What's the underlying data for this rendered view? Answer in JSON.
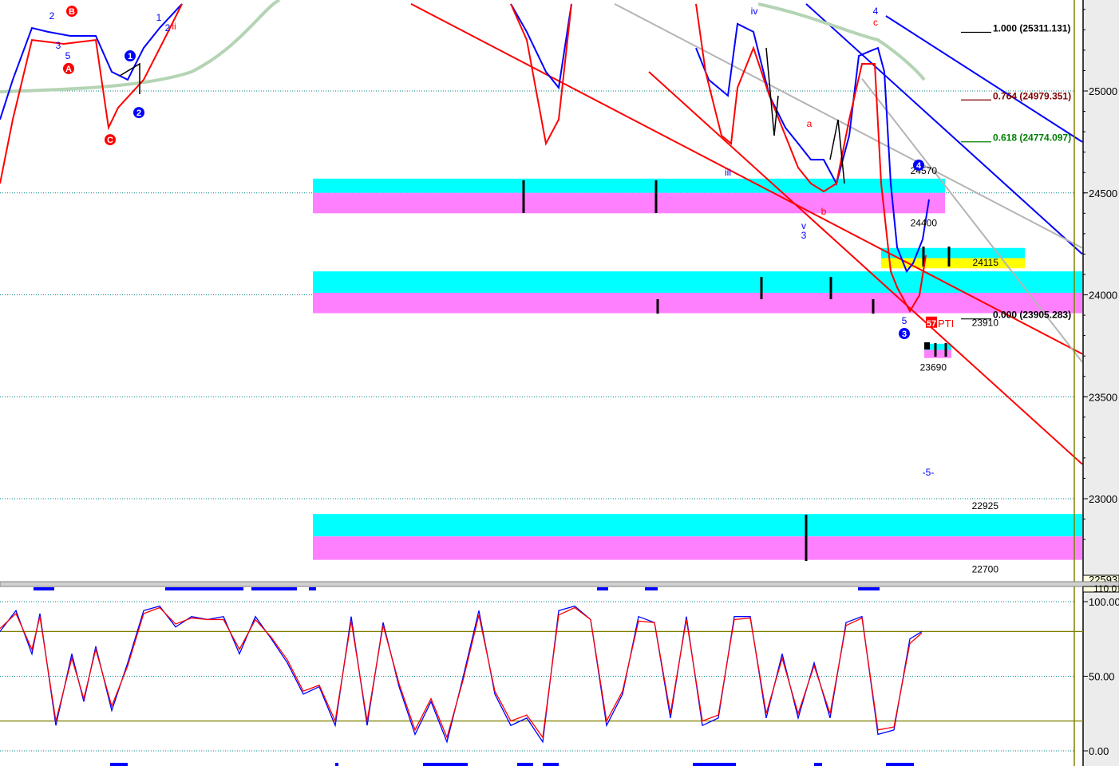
{
  "chart_data": [
    {
      "type": "line",
      "panel": "price",
      "ylim": [
        22593,
        25450
      ],
      "xlim_bars": [
        0,
        350
      ],
      "y_ticks": [
        25000,
        24500,
        24000,
        23500,
        23000
      ],
      "y_tick_labels": [
        "25000",
        "24500",
        "24000",
        "23500",
        "23000"
      ],
      "grid": "dotted horizontal",
      "bottom_readout": "22593",
      "series": [
        {
          "name": "blue-price",
          "color": "#0000ff",
          "segments": [
            [
              [
                0,
                24860
              ],
              [
                4,
                25055
              ],
              [
                10,
                25309
              ],
              [
                15,
                25290
              ],
              [
                22,
                25270
              ],
              [
                30,
                25270
              ],
              [
                35,
                25094
              ],
              [
                40,
                25055
              ],
              [
                45,
                25211
              ],
              [
                50,
                25309
              ],
              [
                57,
                25427
              ]
            ],
            [
              [
                160,
                25427
              ],
              [
                165,
                25290
              ],
              [
                171,
                25094
              ],
              [
                175,
                25016
              ],
              [
                179,
                25427
              ]
            ],
            [
              [
                218,
                25211
              ],
              [
                222,
                25055
              ],
              [
                228,
                24977
              ],
              [
                231,
                25329
              ],
              [
                236,
                25290
              ],
              [
                241,
                24977
              ],
              [
                246,
                24820
              ],
              [
                250,
                24742
              ],
              [
                254,
                24663
              ],
              [
                258,
                24663
              ],
              [
                262,
                24546
              ],
              [
                266,
                24781
              ],
              [
                269,
                25172
              ],
              [
                272,
                25192
              ],
              [
                275,
                25211
              ],
              [
                277,
                25094
              ],
              [
                279,
                24546
              ],
              [
                281,
                24233
              ],
              [
                284,
                24115
              ],
              [
                286,
                24155
              ],
              [
                289,
                24272
              ],
              [
                291,
                24468
              ]
            ]
          ]
        },
        {
          "name": "red-price",
          "color": "#ff0000",
          "segments": [
            [
              [
                0,
                24546
              ],
              [
                4,
                24860
              ],
              [
                10,
                25250
              ],
              [
                20,
                25231
              ],
              [
                30,
                25250
              ],
              [
                34,
                24820
              ],
              [
                37,
                24918
              ],
              [
                45,
                25055
              ],
              [
                52,
                25270
              ],
              [
                57,
                25427
              ]
            ],
            [
              [
                160,
                25427
              ],
              [
                165,
                25250
              ],
              [
                171,
                24742
              ],
              [
                175,
                24860
              ],
              [
                179,
                25427
              ]
            ],
            [
              [
                218,
                25427
              ],
              [
                221,
                25094
              ],
              [
                226,
                24781
              ],
              [
                229,
                24742
              ],
              [
                231,
                25016
              ],
              [
                236,
                25211
              ],
              [
                241,
                24977
              ],
              [
                246,
                24781
              ],
              [
                250,
                24624
              ],
              [
                254,
                24546
              ],
              [
                258,
                24507
              ],
              [
                262,
                24546
              ],
              [
                266,
                24860
              ],
              [
                270,
                25133
              ],
              [
                274,
                25133
              ],
              [
                276,
                24546
              ],
              [
                279,
                24115
              ],
              [
                281,
                24037
              ],
              [
                285,
                23920
              ],
              [
                288,
                23998
              ],
              [
                290,
                24194
              ]
            ]
          ]
        }
      ],
      "trendlines": [
        {
          "color": "#ff0000",
          "from": [
            128.75,
            25427
          ],
          "to": [
            339,
            23710
          ]
        },
        {
          "color": "#ff0000",
          "from": [
            203.25,
            25094
          ],
          "to": [
            339,
            23169
          ]
        },
        {
          "color": "#0000ff",
          "from": [
            252.5,
            25427
          ],
          "to": [
            339,
            24200
          ]
        },
        {
          "color": "#0000ff",
          "from": [
            277.5,
            25368
          ],
          "to": [
            339,
            24750
          ]
        },
        {
          "color": "#b4b4b4",
          "from": [
            192.5,
            25427
          ],
          "to": [
            339,
            24230
          ]
        },
        {
          "color": "#b4b4b4",
          "from": [
            270,
            25060
          ],
          "to": [
            339,
            23670
          ]
        }
      ],
      "zones": [
        {
          "from_bar": 98,
          "to_bar": 296,
          "top": 24570,
          "mid": 24500,
          "bottom": 24400,
          "upper_color": "#00ffff",
          "lower_color": "#ff80ff",
          "label_top": "24570",
          "label_bottom": "24400"
        },
        {
          "from_bar": 98,
          "to_bar": 339,
          "top": 24115,
          "mid": 24010,
          "bottom": 23910,
          "upper_color": "#00ffff",
          "lower_color": "#ff80ff",
          "label_top": "24115",
          "label_bottom": "23910"
        },
        {
          "from_bar": 276,
          "to_bar": 321,
          "top": 24230,
          "mid": 24180,
          "bottom": 24130,
          "upper_color": "#00ffff",
          "lower_color": "#ffff00"
        },
        {
          "from_bar": 289.5,
          "to_bar": 298,
          "top": 23760,
          "mid": 23730,
          "bottom": 23690,
          "upper_color": "#00ffff",
          "lower_color": "#ff80ff",
          "label_bottom": "23690"
        },
        {
          "from_bar": 98,
          "to_bar": 339,
          "top": 22925,
          "mid": 22815,
          "bottom": 22700,
          "upper_color": "#00ffff",
          "lower_color": "#ff80ff",
          "label_top": "22925",
          "label_bottom": "22700"
        }
      ],
      "fib_levels": [
        {
          "label": "1.000 (25311.131)",
          "price": 25311.131,
          "color": "#000000"
        },
        {
          "label": "0.764 (24979.351)",
          "price": 24979.351,
          "color": "#800000"
        },
        {
          "label": "0.618 (24774.097)",
          "price": 24774.097,
          "color": "#008000"
        },
        {
          "label": "0.000 (23905.283)",
          "price": 23905.283,
          "color": "#000000"
        }
      ],
      "wave_labels": [
        {
          "text": "2",
          "bar": 16.25,
          "price": 25368,
          "color": "#0000ff"
        },
        {
          "text": "3",
          "bar": 18.25,
          "price": 25223,
          "color": "#0000ff"
        },
        {
          "text": "5",
          "bar": 21.25,
          "price": 25172,
          "color": "#0000ff"
        },
        {
          "text": "B",
          "bar": 22.5,
          "price": 25391,
          "color": "#ff0000",
          "circle": true
        },
        {
          "text": "A",
          "bar": 21.5,
          "price": 25110,
          "color": "#ff0000",
          "circle": true
        },
        {
          "text": "C",
          "bar": 34.5,
          "price": 24761,
          "color": "#ff0000",
          "circle": true
        },
        {
          "text": "1",
          "bar": 40.75,
          "price": 25172,
          "color": "#0000ff",
          "circle": true
        },
        {
          "text": "2",
          "bar": 43.5,
          "price": 24894,
          "color": "#0000ff",
          "circle": true
        },
        {
          "text": "1",
          "bar": 49.75,
          "price": 25360,
          "color": "#0000ff"
        },
        {
          "text": "2",
          "bar": 52.5,
          "price": 25309,
          "color": "#0000ff"
        },
        {
          "text": "ii",
          "bar": 54.5,
          "price": 25317,
          "color": "#ff0000"
        },
        {
          "text": "iii",
          "bar": 228,
          "price": 24601,
          "color": "#0000ff"
        },
        {
          "text": "iv",
          "bar": 236.25,
          "price": 25391,
          "color": "#0000ff"
        },
        {
          "text": "a",
          "bar": 253.5,
          "price": 24840,
          "color": "#ff0000"
        },
        {
          "text": "b",
          "bar": 258,
          "price": 24409,
          "color": "#ff0000"
        },
        {
          "text": "v",
          "bar": 251.75,
          "price": 24339,
          "color": "#0000ff"
        },
        {
          "text": "3",
          "bar": 251.75,
          "price": 24292,
          "color": "#0000ff"
        },
        {
          "text": "4",
          "bar": 274.25,
          "price": 25391,
          "color": "#0000ff"
        },
        {
          "text": "c",
          "bar": 274.25,
          "price": 25337,
          "color": "#ff0000"
        },
        {
          "text": "4",
          "bar": 287.75,
          "price": 24636,
          "color": "#0000ff",
          "circle": true
        },
        {
          "text": "5",
          "bar": 283.25,
          "price": 23873,
          "color": "#0000ff"
        },
        {
          "text": "3",
          "bar": 283.25,
          "price": 23810,
          "color": "#0000ff",
          "circle": true
        },
        {
          "text": "-5-",
          "bar": 290.75,
          "price": 23129,
          "color": "#0000ff"
        }
      ],
      "signal": {
        "badge": "57",
        "text": "PTI",
        "bar": 291,
        "price": 23862,
        "color": "#ff0000"
      }
    },
    {
      "type": "line",
      "panel": "stochastic",
      "ylim": [
        0,
        110
      ],
      "top_readout": "110.0",
      "y_ticks": [
        100,
        50,
        0
      ],
      "y_tick_labels": [
        "100.00",
        "50.00",
        "0.00"
      ],
      "reference_lines": [
        80,
        20
      ],
      "x_bars": [
        0,
        5,
        10,
        12.5,
        17.5,
        22.5,
        26.25,
        30,
        35,
        40,
        45,
        50,
        55,
        60,
        65,
        70,
        75,
        80,
        85,
        90,
        95,
        100,
        105,
        110,
        115,
        120,
        125,
        130,
        135,
        140,
        145,
        150,
        155,
        160,
        165,
        170,
        175,
        180,
        185,
        190,
        195,
        200,
        205,
        210,
        215,
        220,
        225,
        230,
        235,
        240,
        245,
        250,
        255,
        260,
        265,
        270,
        275,
        280,
        285,
        288.75
      ],
      "series": [
        {
          "name": "%K",
          "color": "#0000ff",
          "values": [
            80,
            94,
            65,
            92,
            17,
            65,
            33,
            70,
            27,
            59,
            94,
            97,
            83,
            90,
            88,
            90,
            65,
            90,
            75,
            59,
            38,
            43,
            17,
            90,
            17,
            86,
            43,
            11,
            33,
            6,
            49,
            94,
            38,
            17,
            22,
            6,
            94,
            97,
            88,
            17,
            38,
            90,
            86,
            22,
            90,
            17,
            22,
            90,
            90,
            22,
            65,
            22,
            59,
            22,
            86,
            90,
            11,
            14,
            75,
            80
          ]
        },
        {
          "name": "%D",
          "color": "#ff0000",
          "values": [
            82,
            92,
            68,
            90,
            20,
            62,
            35,
            68,
            30,
            57,
            92,
            96,
            85,
            89,
            88,
            88,
            68,
            88,
            76,
            61,
            40,
            44,
            20,
            87,
            20,
            84,
            45,
            14,
            35,
            9,
            47,
            91,
            40,
            20,
            24,
            9,
            91,
            96,
            88,
            20,
            40,
            87,
            86,
            25,
            88,
            20,
            24,
            88,
            89,
            25,
            62,
            25,
            57,
            25,
            84,
            89,
            14,
            16,
            72,
            79
          ]
        }
      ]
    }
  ]
}
